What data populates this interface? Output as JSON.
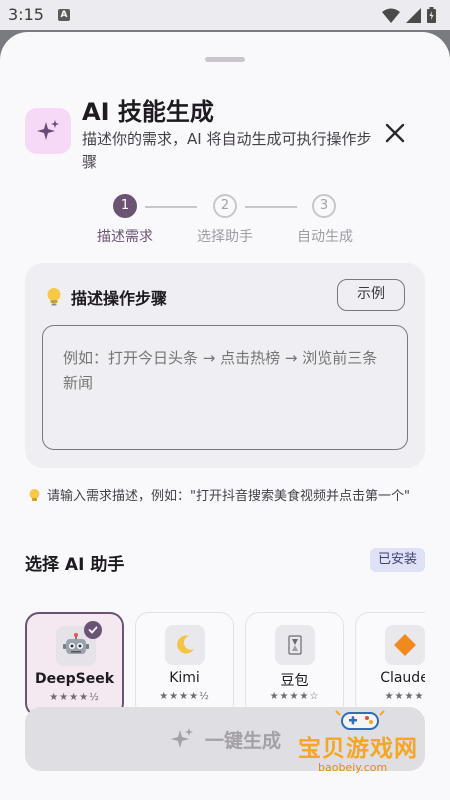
{
  "status_bar": {
    "time": "3:15"
  },
  "dialog": {
    "title": "AI 技能生成",
    "subtitle": "描述你的需求，AI 将自动生成可执行操作步骤"
  },
  "steps": [
    {
      "number": "1",
      "label": "描述需求",
      "active": true
    },
    {
      "number": "2",
      "label": "选择助手",
      "active": false
    },
    {
      "number": "3",
      "label": "自动生成",
      "active": false
    }
  ],
  "description_card": {
    "title": "描述操作步骤",
    "example_button": "示例",
    "input_placeholder": "例如：打开今日头条 → 点击热榜 → 浏览前三条新闻",
    "input_value": ""
  },
  "hint": "请输入需求描述，例如：\"打开抖音搜索美食视频并点击第一个\"",
  "ai_section": {
    "title": "选择 AI 助手",
    "badge": "已安装",
    "assistants": [
      {
        "name": "DeepSeek",
        "stars": "★★★★½",
        "selected": true,
        "icon": "robot-icon"
      },
      {
        "name": "Kimi",
        "stars": "★★★★½",
        "selected": false,
        "icon": "moon-icon"
      },
      {
        "name": "豆包",
        "stars": "★★★★☆",
        "selected": false,
        "icon": "hourglass-icon"
      },
      {
        "name": "Claude",
        "stars": "★★★★",
        "selected": false,
        "icon": "diamond-icon"
      }
    ]
  },
  "generate_button": "一键生成",
  "watermark": {
    "text": "宝贝游戏网",
    "url": "baobeiy.com"
  },
  "colors": {
    "accent": "#6b5374",
    "sheet_bg": "#f9f8fb",
    "card_bg": "#efeef2"
  }
}
